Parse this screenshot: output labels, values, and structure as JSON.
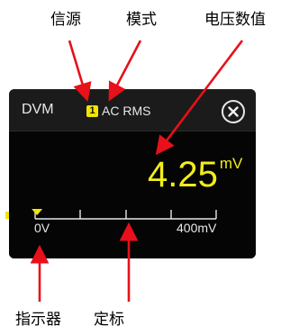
{
  "callouts": {
    "source": "信源",
    "mode": "模式",
    "voltage_value": "电压数值",
    "indicator": "指示器",
    "ruler": "定标"
  },
  "dvm": {
    "title": "DVM",
    "channel": "1",
    "mode": "AC RMS",
    "value": "4.25",
    "unit": "mV",
    "level_fraction": 0.0106,
    "scale": {
      "min_label": "0V",
      "max_label": "400mV"
    }
  },
  "colors": {
    "channel_accent": "#f2e600",
    "reading": "#f2ee1a",
    "callout_arrow": "#e8101a",
    "panel_background": "#050505",
    "header_background": "#1b1b1b"
  },
  "icons": {
    "close": "close-icon",
    "indicator": "triangle-down-icon"
  }
}
